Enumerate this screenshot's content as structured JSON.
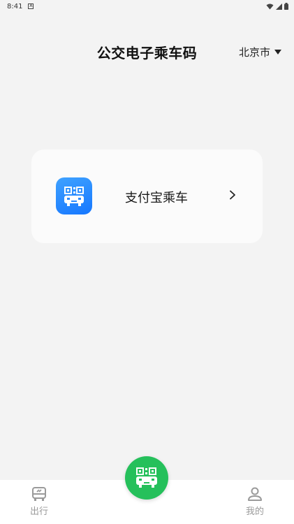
{
  "status_bar": {
    "time": "8:41"
  },
  "header": {
    "title": "公交电子乘车码",
    "city": "北京市"
  },
  "card": {
    "label": "支付宝乘车"
  },
  "bottom_nav": {
    "items": [
      {
        "label": "出行",
        "icon": "bus-icon"
      },
      {
        "label": "我的",
        "icon": "user-icon"
      }
    ],
    "center_icon": "qr-bus-icon"
  },
  "colors": {
    "background": "#f3f3f3",
    "card_bg": "#fbfbfb",
    "alipay_blue": "#1677ff",
    "fab_green": "#25c05b",
    "nav_text": "#9a9a9a"
  }
}
